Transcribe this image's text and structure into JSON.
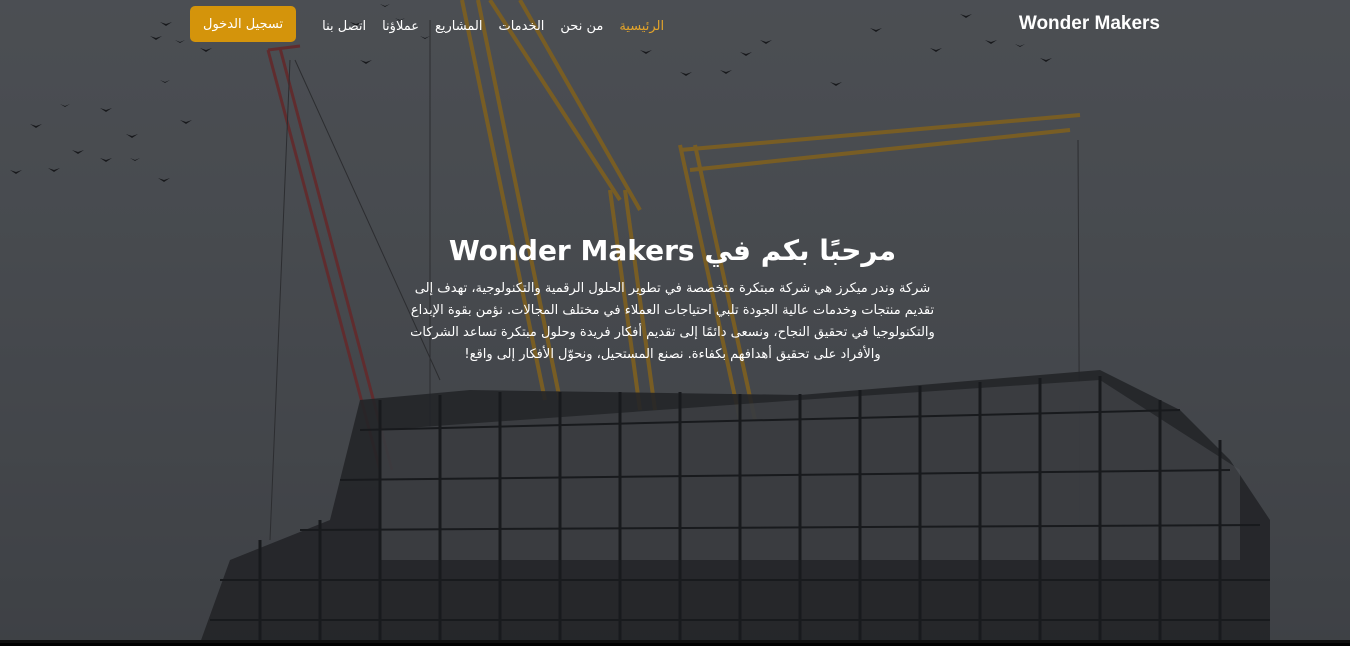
{
  "brand": {
    "name": "Wonder Makers"
  },
  "nav": {
    "items": [
      {
        "label": "الرئيسية",
        "active": true
      },
      {
        "label": "من نحن",
        "active": false
      },
      {
        "label": "الخدمات",
        "active": false
      },
      {
        "label": "المشاريع",
        "active": false
      },
      {
        "label": "عملاؤنا",
        "active": false
      },
      {
        "label": "اتصل بنا",
        "active": false
      }
    ],
    "login_label": "تسجيل الدخول"
  },
  "hero": {
    "title": "مرحبًا بكم في Wonder Makers",
    "description": "شركة وندر ميكرز هي شركة مبتكرة متخصصة في تطوير الحلول الرقمية والتكنولوجية، تهدف إلى تقديم منتجات وخدمات عالية الجودة تلبي احتياجات العملاء في مختلف المجالات. نؤمن بقوة الإبداع والتكنولوجيا في تحقيق النجاح، ونسعى دائمًا إلى تقديم أفكار فريدة وحلول مبتكرة تساعد الشركات والأفراد على تحقيق أهدافهم بكفاءة. نصنع المستحيل، ونحوّل الأفكار إلى واقع!"
  },
  "colors": {
    "accent": "#d4940b",
    "active_link": "#e3a42a",
    "text": "#ffffff"
  }
}
